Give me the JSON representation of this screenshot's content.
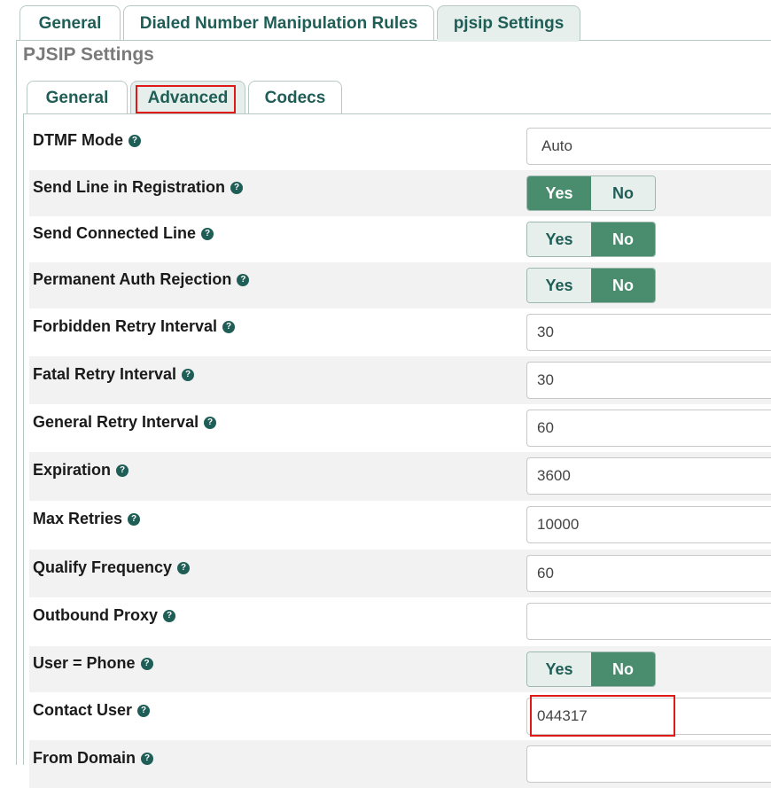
{
  "top_tabs": [
    "General",
    "Dialed Number Manipulation Rules",
    "pjsip Settings"
  ],
  "section_title": "PJSIP Settings",
  "inner_tabs": [
    "General",
    "Advanced",
    "Codecs"
  ],
  "colors": {
    "accent": "#1f5e56",
    "toggle_on": "#4a8c6e",
    "highlight": "#e01818"
  },
  "toggle_labels": {
    "yes": "Yes",
    "no": "No"
  },
  "help_icon": "question-circle-icon",
  "fields": {
    "dtmf_mode": {
      "label": "DTMF Mode",
      "value": "Auto"
    },
    "send_line_in_registration": {
      "label": "Send Line in Registration",
      "selected": "Yes"
    },
    "send_connected_line": {
      "label": "Send Connected Line",
      "selected": "No"
    },
    "permanent_auth_rejection": {
      "label": "Permanent Auth Rejection",
      "selected": "No"
    },
    "forbidden_retry_interval": {
      "label": "Forbidden Retry Interval",
      "value": "30"
    },
    "fatal_retry_interval": {
      "label": "Fatal Retry Interval",
      "value": "30"
    },
    "general_retry_interval": {
      "label": "General Retry Interval",
      "value": "60"
    },
    "expiration": {
      "label": "Expiration",
      "value": "3600"
    },
    "max_retries": {
      "label": "Max Retries",
      "value": "10000"
    },
    "qualify_frequency": {
      "label": "Qualify Frequency",
      "value": "60"
    },
    "outbound_proxy": {
      "label": "Outbound Proxy",
      "value": ""
    },
    "user_phone": {
      "label": "User = Phone",
      "selected": "No"
    },
    "contact_user": {
      "label": "Contact User",
      "value": "044317"
    },
    "from_domain": {
      "label": "From Domain",
      "value": ""
    }
  }
}
